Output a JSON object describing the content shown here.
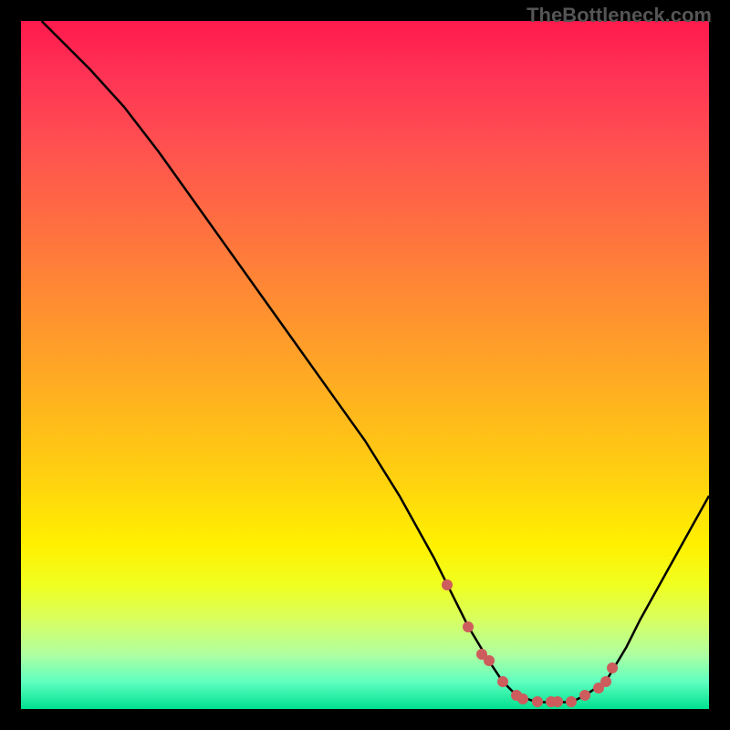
{
  "watermark": "TheBottleneck.com",
  "chart_data": {
    "type": "line",
    "title": "",
    "xlabel": "",
    "ylabel": "",
    "xlim": [
      0,
      100
    ],
    "ylim": [
      0,
      100
    ],
    "series": [
      {
        "name": "curve",
        "x": [
          3,
          10,
          15,
          20,
          25,
          30,
          35,
          40,
          45,
          50,
          55,
          60,
          62,
          65,
          68,
          70,
          72,
          75,
          78,
          80,
          82,
          85,
          88,
          90,
          95,
          100
        ],
        "y": [
          100,
          93,
          87.5,
          81,
          74,
          67,
          60,
          53,
          46,
          39,
          31,
          22,
          18,
          12,
          7,
          4,
          2,
          1,
          1,
          1,
          2,
          4,
          9,
          13,
          22,
          31
        ]
      }
    ],
    "markers": {
      "x": [
        62,
        65,
        67,
        68,
        70,
        72,
        73,
        75,
        77,
        78,
        80,
        82,
        84,
        85,
        86
      ],
      "y": [
        18,
        12,
        8,
        7,
        4,
        2,
        1.5,
        1,
        1,
        1,
        1,
        2,
        3,
        4,
        6
      ]
    }
  }
}
